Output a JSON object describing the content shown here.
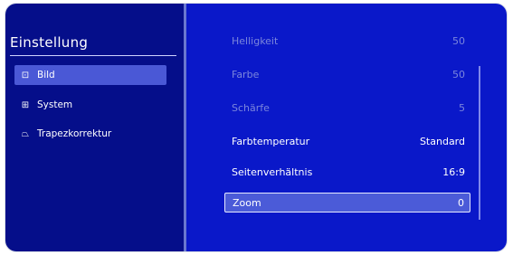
{
  "sidebar": {
    "title": "Einstellung",
    "items": [
      {
        "label": "Bild",
        "icon": "picture-icon",
        "glyph": "⊡",
        "active": true
      },
      {
        "label": "System",
        "icon": "system-icon",
        "glyph": "⊞",
        "active": false
      },
      {
        "label": "Trapezkorrektur",
        "icon": "keystone-icon",
        "glyph": "⏢",
        "active": false
      }
    ]
  },
  "settings": {
    "rows": [
      {
        "label": "Helligkeit",
        "value": "50",
        "dimmed": true
      },
      {
        "label": "Farbe",
        "value": "50",
        "dimmed": true
      },
      {
        "label": "Schärfe",
        "value": "5",
        "dimmed": true
      },
      {
        "label": "Farbtemperatur",
        "value": "Standard",
        "dimmed": false
      },
      {
        "label": "Seitenverhältnis",
        "value": "16:9",
        "dimmed": false
      },
      {
        "label": "Zoom",
        "value": "0",
        "dimmed": false,
        "selected": true
      }
    ]
  },
  "colors": {
    "sidebar_bg": "#050e8a",
    "main_bg": "#0a18c9",
    "highlight": "#4b5bd8",
    "dimmed_text": "#7b86dc"
  }
}
